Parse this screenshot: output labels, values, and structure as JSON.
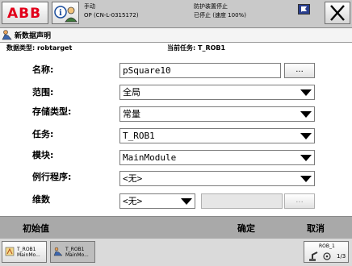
{
  "status": {
    "mode": "手动",
    "controller": "OP (CN-L-0315172)",
    "safety": "防护装置停止",
    "state": "已停止 (速度 100%)"
  },
  "window": {
    "title": "新数据声明"
  },
  "info": {
    "datatype_label": "数据类型: robtarget",
    "task_label": "当前任务:  T_ROB1"
  },
  "form": {
    "name_label": "名称:",
    "name_value": "pSquare10",
    "name_button": "...",
    "scope_label": "范围:",
    "scope_value": "全局",
    "storage_label": "存储类型:",
    "storage_value": "常量",
    "task_label": "任务:",
    "task_value": "T_ROB1",
    "module_label": "模块:",
    "module_value": "MainModule",
    "routine_label": "例行程序:",
    "routine_value": "<无>",
    "dim_label": "维数",
    "dim_value": "<无>",
    "dim_button": "..."
  },
  "commands": {
    "init": "初始值",
    "ok": "确定",
    "cancel": "取消"
  },
  "taskbar": {
    "task1_line1": "T_ROB1",
    "task1_line2": "MainMo...",
    "task2_line1": "T_ROB1",
    "task2_line2": "MainMo...",
    "robot": "ROB_1",
    "speed_corner": "1/3"
  },
  "colors": {
    "abb_red": "#e2001a",
    "topbar_bg": "#c9c9c9",
    "cmdbar_bg": "#a9a9a9"
  }
}
